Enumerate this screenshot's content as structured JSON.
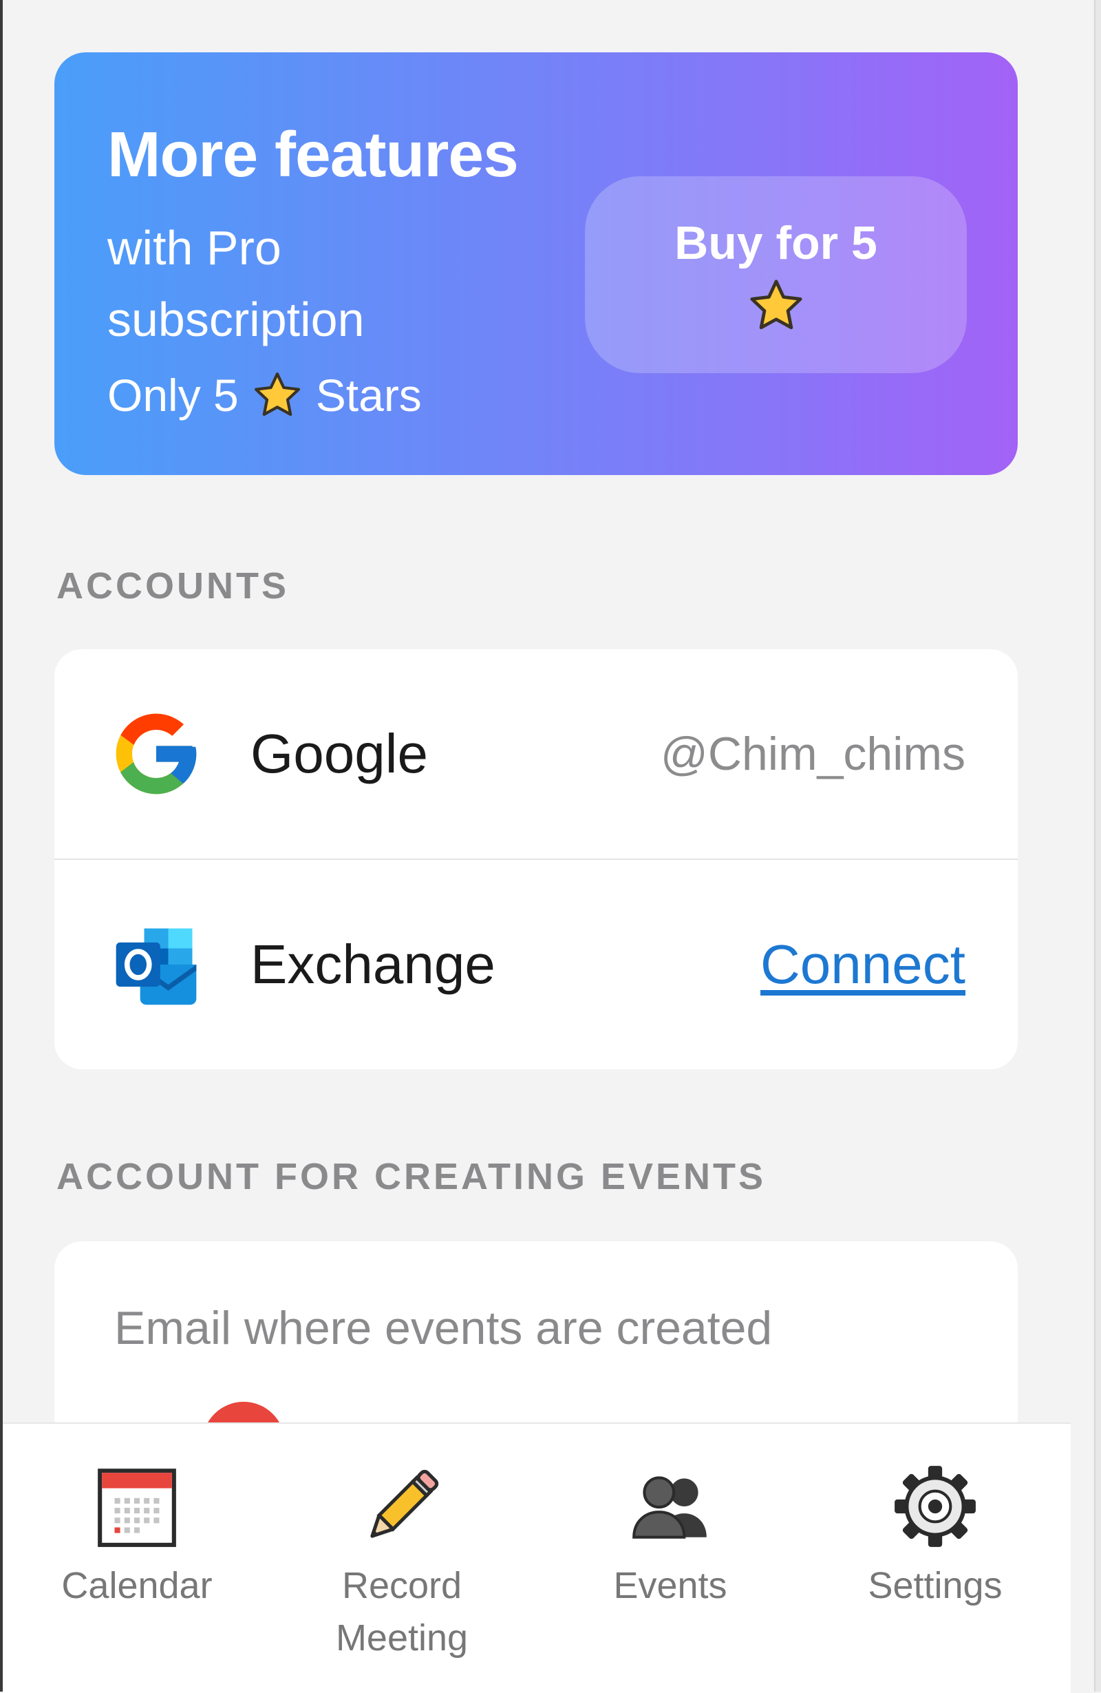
{
  "promo": {
    "title": "More features",
    "subtitle": "with Pro subscription",
    "price_prefix": "Only 5",
    "price_suffix": "Stars",
    "buy_label": "Buy for 5",
    "star_icon": "star-icon",
    "gradient_colors": [
      "#4a9ef9",
      "#a362f6"
    ]
  },
  "accounts": {
    "section_label": "ACCOUNTS",
    "items": [
      {
        "name": "Google",
        "icon": "google-icon",
        "value": "@Chim_chims"
      },
      {
        "name": "Exchange",
        "icon": "outlook-icon",
        "action": "Connect"
      }
    ]
  },
  "events_account": {
    "section_label": "ACCOUNT FOR CREATING EVENTS",
    "hint": "Email where events are created"
  },
  "bottom_nav": {
    "items": [
      {
        "label": "Calendar",
        "icon": "calendar-icon"
      },
      {
        "label": "Record Meeting",
        "icon": "pencil-icon"
      },
      {
        "label": "Events",
        "icon": "people-icon"
      },
      {
        "label": "Settings",
        "icon": "gear-icon"
      }
    ]
  },
  "colors": {
    "link": "#1d78d2",
    "background": "#f3f3f4",
    "muted_text": "#8a8a8c"
  }
}
